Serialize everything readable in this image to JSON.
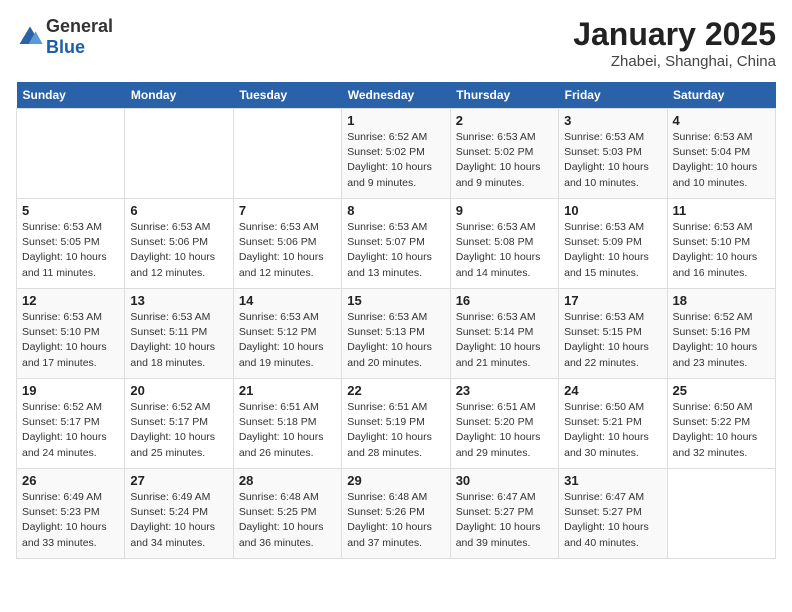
{
  "header": {
    "logo_general": "General",
    "logo_blue": "Blue",
    "title": "January 2025",
    "location": "Zhabei, Shanghai, China"
  },
  "weekdays": [
    "Sunday",
    "Monday",
    "Tuesday",
    "Wednesday",
    "Thursday",
    "Friday",
    "Saturday"
  ],
  "weeks": [
    [
      {
        "day": "",
        "info": ""
      },
      {
        "day": "",
        "info": ""
      },
      {
        "day": "",
        "info": ""
      },
      {
        "day": "1",
        "info": "Sunrise: 6:52 AM\nSunset: 5:02 PM\nDaylight: 10 hours\nand 9 minutes."
      },
      {
        "day": "2",
        "info": "Sunrise: 6:53 AM\nSunset: 5:02 PM\nDaylight: 10 hours\nand 9 minutes."
      },
      {
        "day": "3",
        "info": "Sunrise: 6:53 AM\nSunset: 5:03 PM\nDaylight: 10 hours\nand 10 minutes."
      },
      {
        "day": "4",
        "info": "Sunrise: 6:53 AM\nSunset: 5:04 PM\nDaylight: 10 hours\nand 10 minutes."
      }
    ],
    [
      {
        "day": "5",
        "info": "Sunrise: 6:53 AM\nSunset: 5:05 PM\nDaylight: 10 hours\nand 11 minutes."
      },
      {
        "day": "6",
        "info": "Sunrise: 6:53 AM\nSunset: 5:06 PM\nDaylight: 10 hours\nand 12 minutes."
      },
      {
        "day": "7",
        "info": "Sunrise: 6:53 AM\nSunset: 5:06 PM\nDaylight: 10 hours\nand 12 minutes."
      },
      {
        "day": "8",
        "info": "Sunrise: 6:53 AM\nSunset: 5:07 PM\nDaylight: 10 hours\nand 13 minutes."
      },
      {
        "day": "9",
        "info": "Sunrise: 6:53 AM\nSunset: 5:08 PM\nDaylight: 10 hours\nand 14 minutes."
      },
      {
        "day": "10",
        "info": "Sunrise: 6:53 AM\nSunset: 5:09 PM\nDaylight: 10 hours\nand 15 minutes."
      },
      {
        "day": "11",
        "info": "Sunrise: 6:53 AM\nSunset: 5:10 PM\nDaylight: 10 hours\nand 16 minutes."
      }
    ],
    [
      {
        "day": "12",
        "info": "Sunrise: 6:53 AM\nSunset: 5:10 PM\nDaylight: 10 hours\nand 17 minutes."
      },
      {
        "day": "13",
        "info": "Sunrise: 6:53 AM\nSunset: 5:11 PM\nDaylight: 10 hours\nand 18 minutes."
      },
      {
        "day": "14",
        "info": "Sunrise: 6:53 AM\nSunset: 5:12 PM\nDaylight: 10 hours\nand 19 minutes."
      },
      {
        "day": "15",
        "info": "Sunrise: 6:53 AM\nSunset: 5:13 PM\nDaylight: 10 hours\nand 20 minutes."
      },
      {
        "day": "16",
        "info": "Sunrise: 6:53 AM\nSunset: 5:14 PM\nDaylight: 10 hours\nand 21 minutes."
      },
      {
        "day": "17",
        "info": "Sunrise: 6:53 AM\nSunset: 5:15 PM\nDaylight: 10 hours\nand 22 minutes."
      },
      {
        "day": "18",
        "info": "Sunrise: 6:52 AM\nSunset: 5:16 PM\nDaylight: 10 hours\nand 23 minutes."
      }
    ],
    [
      {
        "day": "19",
        "info": "Sunrise: 6:52 AM\nSunset: 5:17 PM\nDaylight: 10 hours\nand 24 minutes."
      },
      {
        "day": "20",
        "info": "Sunrise: 6:52 AM\nSunset: 5:17 PM\nDaylight: 10 hours\nand 25 minutes."
      },
      {
        "day": "21",
        "info": "Sunrise: 6:51 AM\nSunset: 5:18 PM\nDaylight: 10 hours\nand 26 minutes."
      },
      {
        "day": "22",
        "info": "Sunrise: 6:51 AM\nSunset: 5:19 PM\nDaylight: 10 hours\nand 28 minutes."
      },
      {
        "day": "23",
        "info": "Sunrise: 6:51 AM\nSunset: 5:20 PM\nDaylight: 10 hours\nand 29 minutes."
      },
      {
        "day": "24",
        "info": "Sunrise: 6:50 AM\nSunset: 5:21 PM\nDaylight: 10 hours\nand 30 minutes."
      },
      {
        "day": "25",
        "info": "Sunrise: 6:50 AM\nSunset: 5:22 PM\nDaylight: 10 hours\nand 32 minutes."
      }
    ],
    [
      {
        "day": "26",
        "info": "Sunrise: 6:49 AM\nSunset: 5:23 PM\nDaylight: 10 hours\nand 33 minutes."
      },
      {
        "day": "27",
        "info": "Sunrise: 6:49 AM\nSunset: 5:24 PM\nDaylight: 10 hours\nand 34 minutes."
      },
      {
        "day": "28",
        "info": "Sunrise: 6:48 AM\nSunset: 5:25 PM\nDaylight: 10 hours\nand 36 minutes."
      },
      {
        "day": "29",
        "info": "Sunrise: 6:48 AM\nSunset: 5:26 PM\nDaylight: 10 hours\nand 37 minutes."
      },
      {
        "day": "30",
        "info": "Sunrise: 6:47 AM\nSunset: 5:27 PM\nDaylight: 10 hours\nand 39 minutes."
      },
      {
        "day": "31",
        "info": "Sunrise: 6:47 AM\nSunset: 5:27 PM\nDaylight: 10 hours\nand 40 minutes."
      },
      {
        "day": "",
        "info": ""
      }
    ]
  ]
}
